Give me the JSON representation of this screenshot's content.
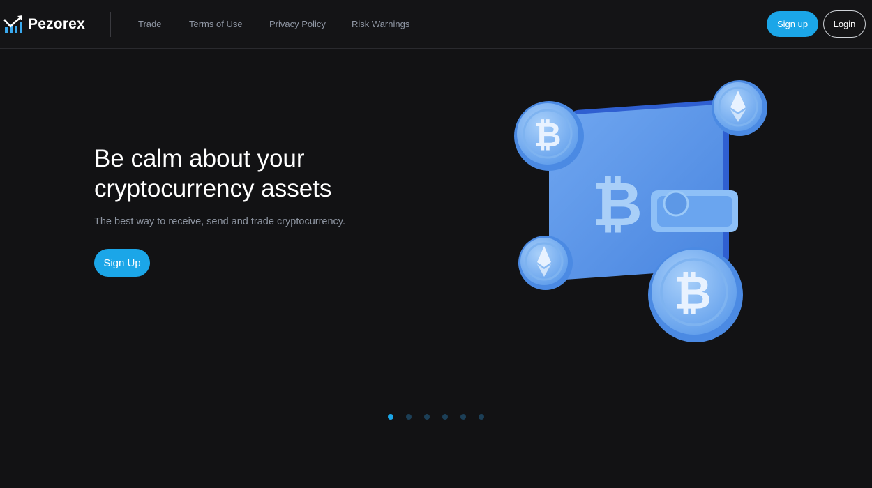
{
  "brand": {
    "name": "Pezorex",
    "logo_icon": "bar-chart-arrow-icon"
  },
  "nav": {
    "links": [
      {
        "label": "Trade"
      },
      {
        "label": "Terms of Use"
      },
      {
        "label": "Privacy Policy"
      },
      {
        "label": "Risk Warnings"
      }
    ]
  },
  "auth": {
    "signup_label": "Sign up",
    "login_label": "Login"
  },
  "hero": {
    "title": "Be calm about your cryptocurrency assets",
    "subtitle": "The best way to receive, send and trade cryptocurrency.",
    "cta_label": "Sign Up",
    "illustration_icon": "crypto-wallet-icon"
  },
  "carousel": {
    "slide_count": 6,
    "active_index": 0
  },
  "colors": {
    "accent": "#1ba6e8",
    "background": "#121214",
    "nav_text": "#8f96a3",
    "subtitle_text": "#8d94a0",
    "wallet_blue": "#5a95ea",
    "coin_blue": "#7ab4f3"
  }
}
